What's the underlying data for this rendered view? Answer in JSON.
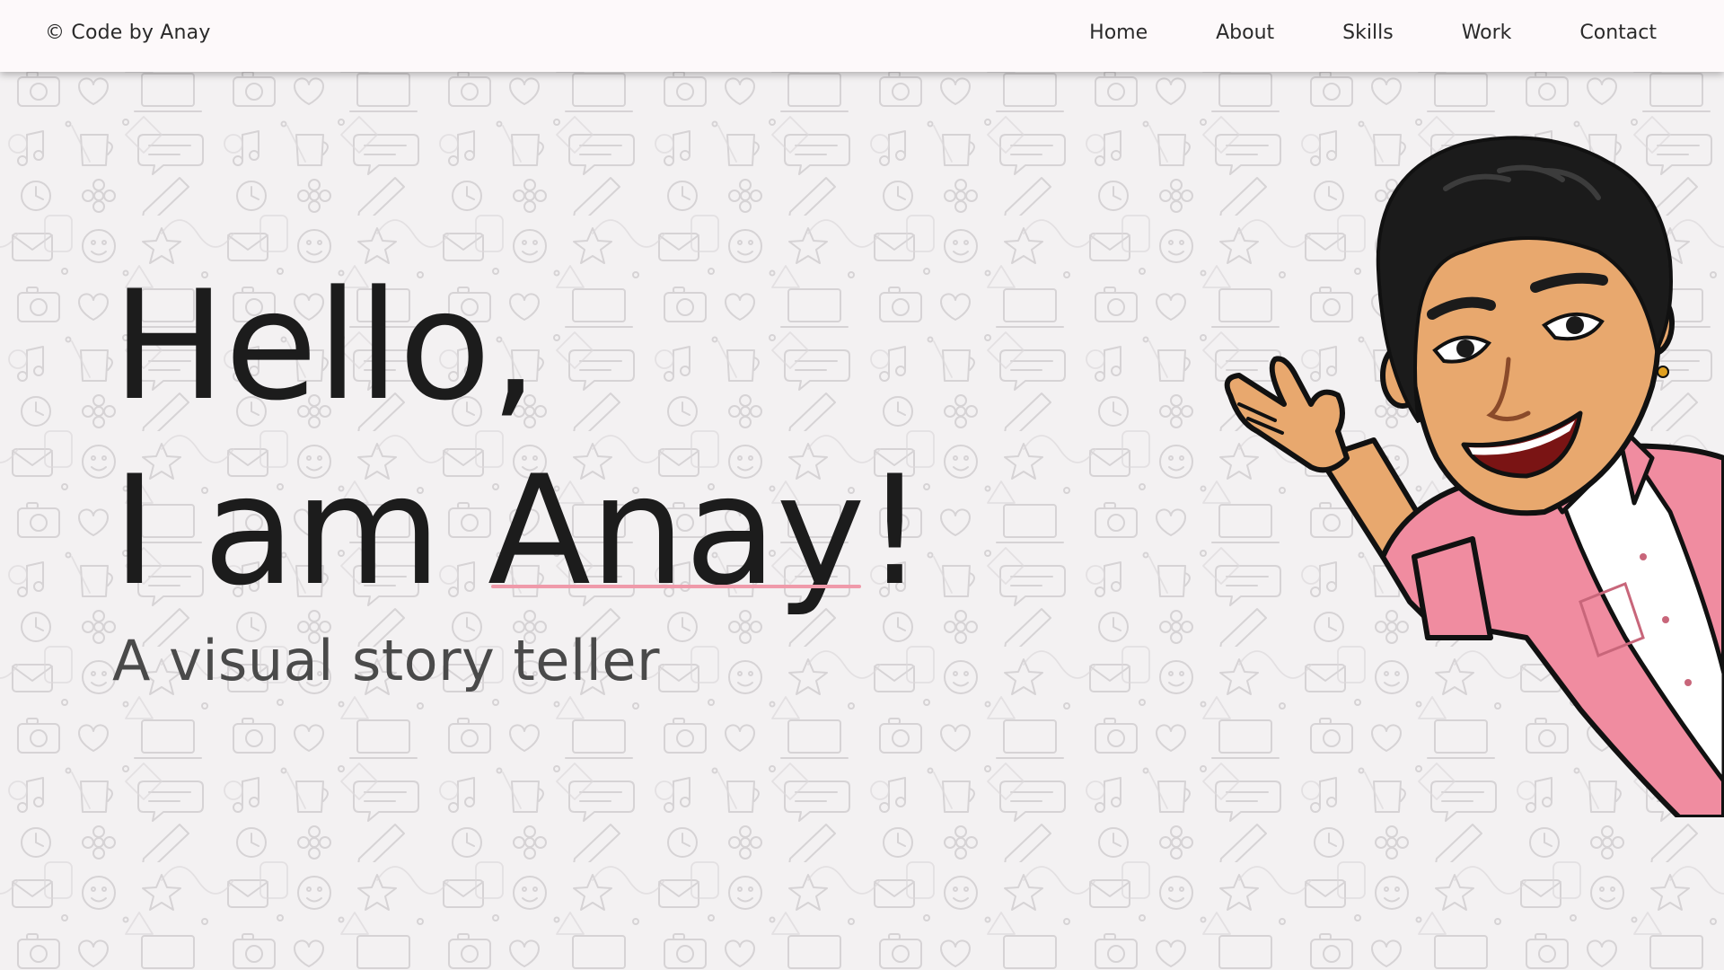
{
  "header": {
    "brand": "© Code by Anay",
    "nav": [
      "Home",
      "About",
      "Skills",
      "Work",
      "Contact"
    ]
  },
  "hero": {
    "greeting": "Hello,",
    "intro_prefix": "I am ",
    "name": "Anay",
    "exclaim": "!",
    "tagline": "A visual story teller"
  },
  "colors": {
    "accent_underline": "#ef9aaa",
    "shirt": "#f08ca0",
    "skin": "#e8a86e",
    "hair": "#1b1b1b",
    "background": "#f3f1f2",
    "navbar": "#fdf9fa"
  },
  "icons": {
    "background": "doodle-pattern",
    "avatar": "waving-avatar"
  }
}
